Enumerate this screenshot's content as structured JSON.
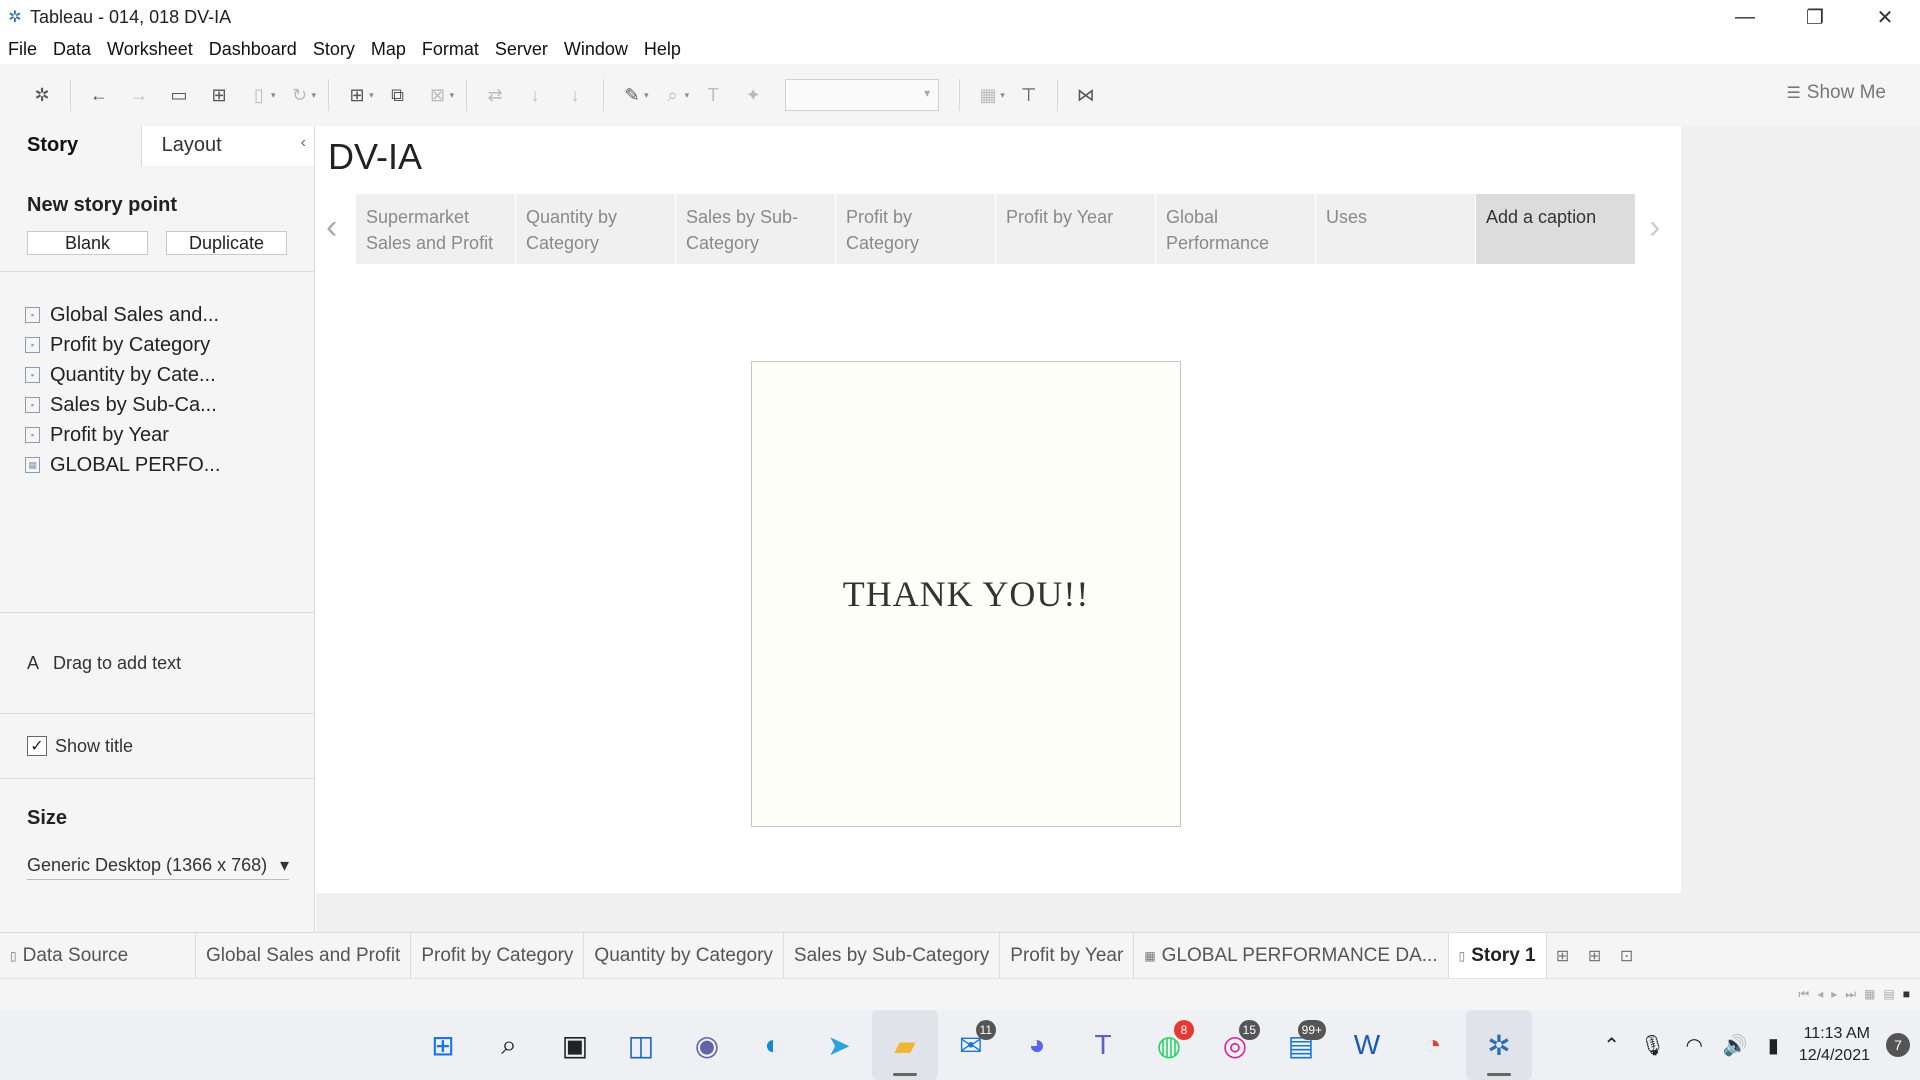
{
  "window": {
    "title": "Tableau - 014, 018 DV-IA",
    "minimize": "—",
    "restore": "❐",
    "close": "✕"
  },
  "menu": [
    "File",
    "Data",
    "Worksheet",
    "Dashboard",
    "Story",
    "Map",
    "Format",
    "Server",
    "Window",
    "Help"
  ],
  "toolbar": {
    "show_me": "Show Me"
  },
  "left_panel": {
    "tabs": [
      "Story",
      "Layout"
    ],
    "new_story_point": "New story point",
    "blank_button": "Blank",
    "duplicate_button": "Duplicate",
    "sheets": [
      "Global Sales and...",
      "Profit by Category",
      "Quantity by Cate...",
      "Sales by Sub-Ca...",
      "Profit by Year",
      "GLOBAL PERFO..."
    ],
    "drag_text": "Drag to add text",
    "drag_glyph": "A",
    "show_title": "Show title",
    "size_title": "Size",
    "size_value": "Generic Desktop (1366 x 768)"
  },
  "story": {
    "title": "DV-IA",
    "points": [
      "Supermarket Sales and Profit",
      "Quantity by Category",
      "Sales by Sub-Category",
      "Profit by Category",
      "Profit by Year",
      "Global Performance",
      "Uses",
      "Add a caption"
    ],
    "active_index": 7,
    "card_text": "THANK YOU!!"
  },
  "sheet_tabs": {
    "data_source": "Data Source",
    "tabs": [
      "Global Sales and Profit",
      "Profit by Category",
      "Quantity by Category",
      "Sales by Sub-Category",
      "Profit by Year",
      "GLOBAL PERFORMANCE DA..."
    ],
    "active": "Story 1"
  },
  "taskbar": {
    "badges": {
      "mail": "11",
      "whatsapp": "8",
      "instagram": "15",
      "news": "99+"
    },
    "time": "11:13 AM",
    "date": "12/4/2021",
    "notifications": "7"
  }
}
